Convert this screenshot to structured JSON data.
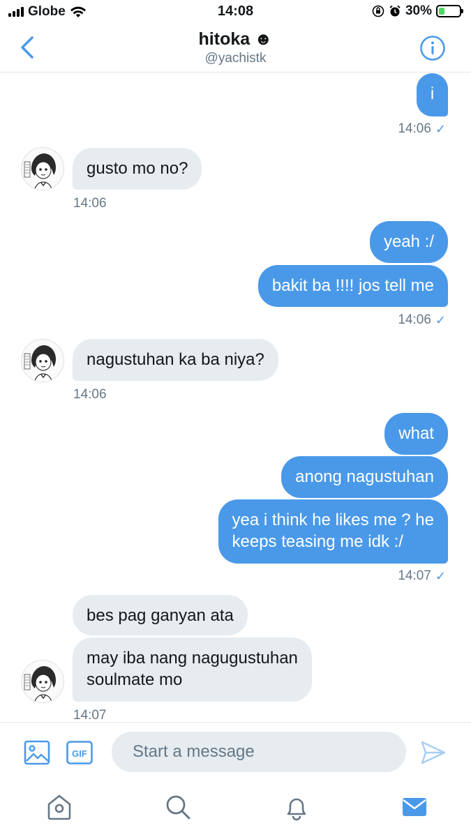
{
  "status_bar": {
    "carrier": "Globe",
    "time": "14:08",
    "battery": "30%",
    "battery_level": 0.3,
    "icons": [
      "signal-icon",
      "wifi-icon",
      "orientation-lock-icon",
      "alarm-icon",
      "battery-icon"
    ]
  },
  "header": {
    "title": "hitoka",
    "title_emoji": "☻",
    "handle": "@yachistk",
    "icons": [
      "back-chevron-icon",
      "info-icon"
    ]
  },
  "messages": [
    {
      "dir": "out",
      "text": "i"
    },
    {
      "dir": "out",
      "time": "14:06",
      "status": "✓"
    },
    {
      "dir": "in",
      "text": "gusto mo no?"
    },
    {
      "dir": "in",
      "time": "14:06"
    },
    {
      "dir": "out",
      "text": "yeah :/"
    },
    {
      "dir": "out",
      "text": "bakit ba !!!! jos tell me"
    },
    {
      "dir": "out",
      "time": "14:06",
      "status": "✓"
    },
    {
      "dir": "in",
      "text": "nagustuhan ka ba niya?"
    },
    {
      "dir": "in",
      "time": "14:06"
    },
    {
      "dir": "out",
      "text": "what"
    },
    {
      "dir": "out",
      "text": "anong nagustuhan"
    },
    {
      "dir": "out",
      "text_line1": "yea i think he likes me ? he",
      "text_line2": "keeps teasing me idk :/"
    },
    {
      "dir": "out",
      "time": "14:07",
      "status": "✓"
    },
    {
      "dir": "in",
      "text": "bes pag ganyan ata"
    },
    {
      "dir": "in",
      "text_line1": "may iba nang nagugustuhan",
      "text_line2": "soulmate mo"
    },
    {
      "dir": "in",
      "time": "14:07"
    }
  ],
  "composer": {
    "placeholder": "Start a message",
    "gif_label": "GIF",
    "icons": [
      "image-icon",
      "gif-icon",
      "send-icon"
    ]
  },
  "tabbar": {
    "items": [
      "home",
      "search",
      "notifications",
      "messages"
    ],
    "active": "messages",
    "accent": "#4a99e9"
  },
  "colors": {
    "outgoing_bubble": "#4a99e9",
    "incoming_bubble": "#e6ecf0",
    "secondary_text": "#657786"
  }
}
